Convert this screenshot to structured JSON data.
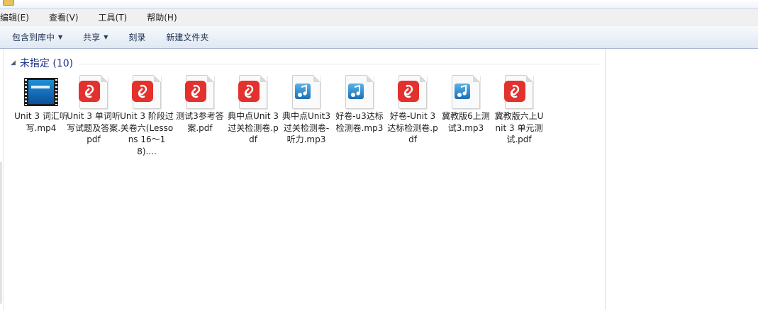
{
  "menubar": {
    "items": [
      "编辑(E)",
      "查看(V)",
      "工具(T)",
      "帮助(H)"
    ]
  },
  "toolbar": {
    "include_library": "包含到库中",
    "share": "共享",
    "burn": "刻录",
    "new_folder": "新建文件夹"
  },
  "group": {
    "title": "未指定 (10)"
  },
  "files": [
    {
      "name": "Unit 3 词汇听写.mp4",
      "type": "video"
    },
    {
      "name": "Unit 3 单词听写试题及答案.pdf",
      "type": "pdf"
    },
    {
      "name": "Unit 3 阶段过关卷六(Lessons 16～18)....",
      "type": "pdf"
    },
    {
      "name": "测试3参考答案.pdf",
      "type": "pdf"
    },
    {
      "name": "典中点Unit 3 过关检测卷.pdf",
      "type": "pdf"
    },
    {
      "name": "典中点Unit3 过关检测卷-听力.mp3",
      "type": "audio"
    },
    {
      "name": "好卷-u3达标检测卷.mp3",
      "type": "audio"
    },
    {
      "name": "好卷-Unit 3达标检测卷.pdf",
      "type": "pdf"
    },
    {
      "name": "冀教版6上测试3.mp3",
      "type": "audio"
    },
    {
      "name": "冀教版六上Unit 3 单元测试.pdf",
      "type": "pdf"
    }
  ],
  "colors": {
    "pdf_badge": "#e3312d",
    "group_title": "#1e3287",
    "toolbar_bg": "#dfe8f3"
  }
}
